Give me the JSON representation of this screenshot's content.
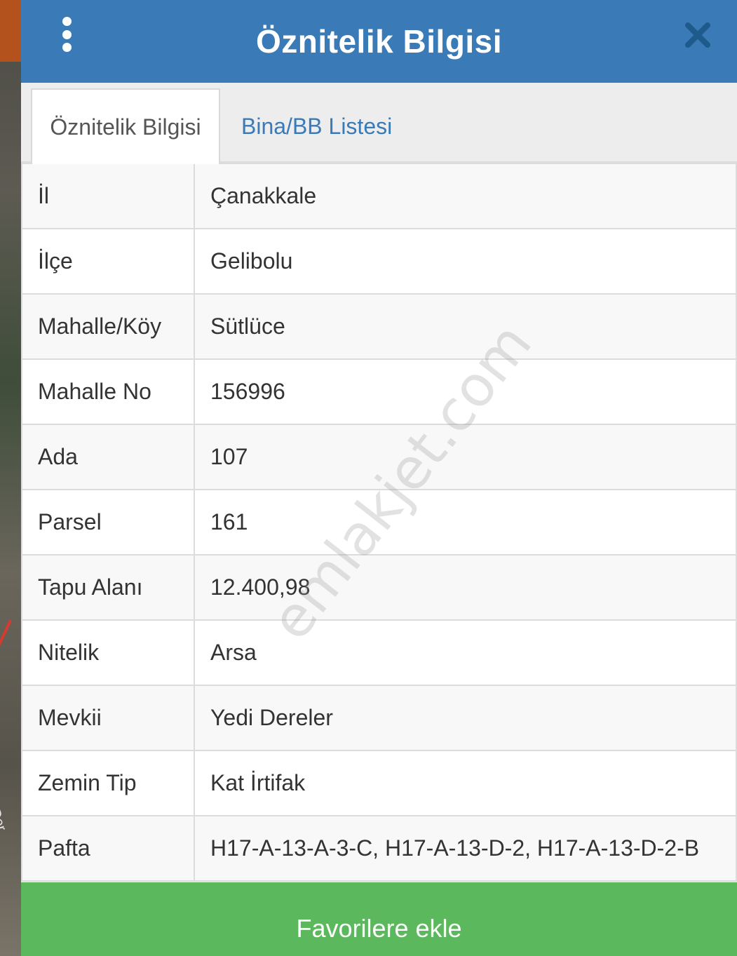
{
  "map": {
    "visible_text": "Der"
  },
  "header": {
    "title": "Öznitelik Bilgisi"
  },
  "tabs": [
    {
      "label": "Öznitelik Bilgisi",
      "active": true
    },
    {
      "label": "Bina/BB Listesi",
      "active": false
    }
  ],
  "attributes": [
    {
      "key": "İl",
      "value": "Çanakkale"
    },
    {
      "key": "İlçe",
      "value": "Gelibolu"
    },
    {
      "key": "Mahalle/Köy",
      "value": "Sütlüce"
    },
    {
      "key": "Mahalle No",
      "value": "156996"
    },
    {
      "key": "Ada",
      "value": "107"
    },
    {
      "key": "Parsel",
      "value": "161"
    },
    {
      "key": "Tapu Alanı",
      "value": "12.400,98"
    },
    {
      "key": "Nitelik",
      "value": "Arsa"
    },
    {
      "key": "Mevkii",
      "value": "Yedi Dereler"
    },
    {
      "key": "Zemin Tip",
      "value": "Kat İrtifak"
    },
    {
      "key": "Pafta",
      "value": "H17-A-13-A-3-C, H17-A-13-D-2, H17-A-13-D-2-B"
    }
  ],
  "watermark": "emlakjet.com",
  "footer": {
    "favorite_label": "Favorilere ekle"
  },
  "colors": {
    "header": "#3a7ab6",
    "favorite_button": "#5cb85c",
    "tab_link": "#3a7ab6"
  }
}
